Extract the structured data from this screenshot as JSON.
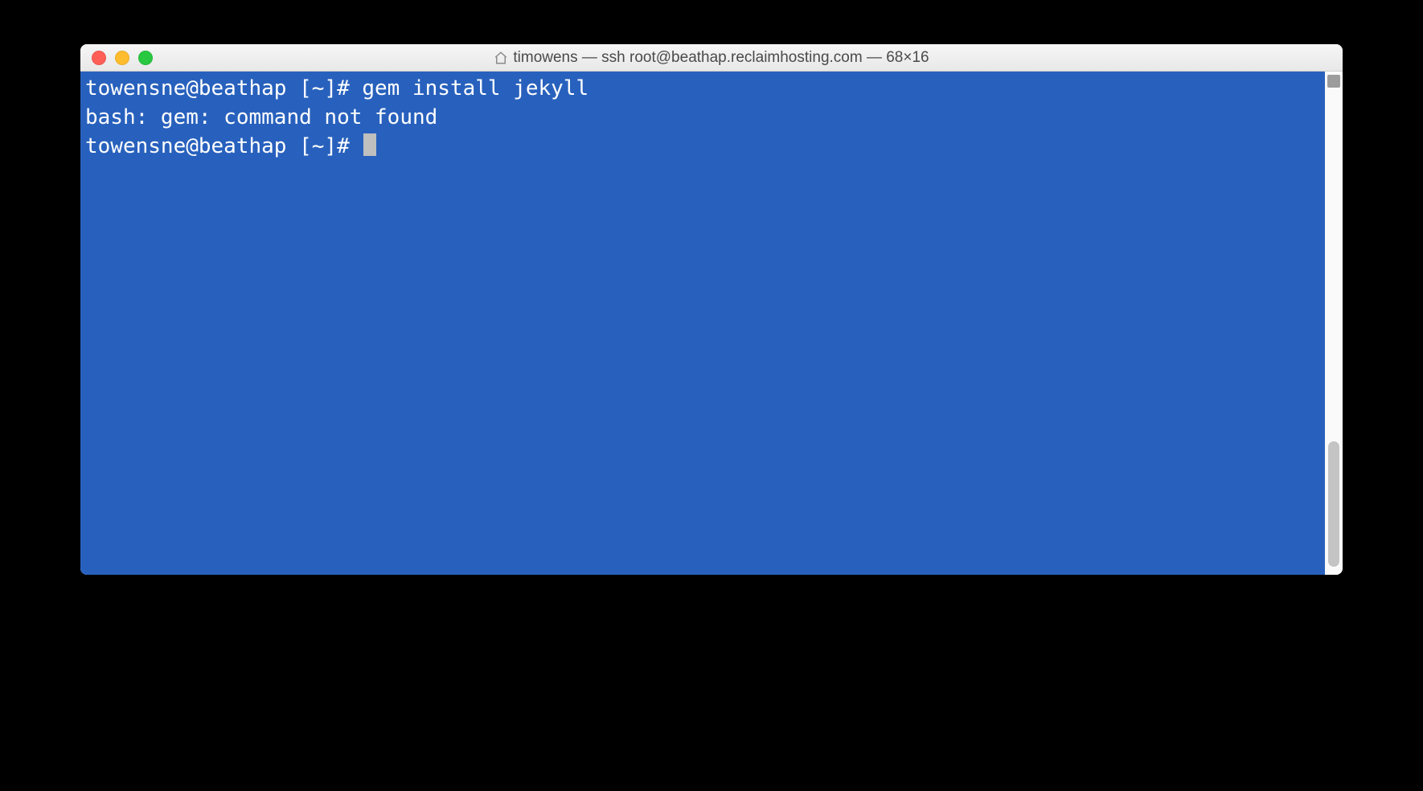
{
  "titlebar": {
    "title": "timowens — ssh root@beathap.reclaimhosting.com — 68×16"
  },
  "terminal": {
    "lines": [
      {
        "prompt": "towensne@beathap [~]# ",
        "command": "gem install jekyll"
      },
      {
        "text": "bash: gem: command not found"
      },
      {
        "prompt": "towensne@beathap [~]# ",
        "cursor": true
      }
    ],
    "background_color": "#2861bd",
    "text_color": "#ffffff"
  }
}
